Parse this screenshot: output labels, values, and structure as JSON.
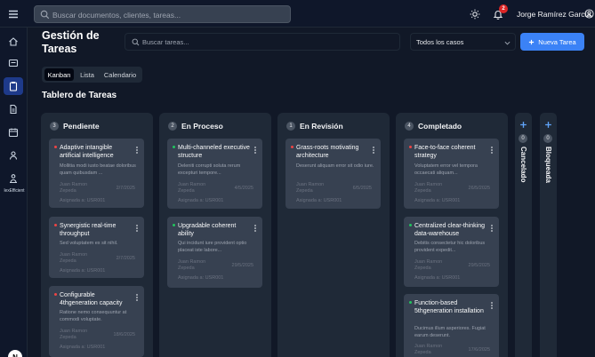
{
  "topbar": {
    "search_placeholder": "Buscar documentos, clientes, tareas...",
    "notifications_count": "2",
    "user_name": "Jorge Ramírez García"
  },
  "sidebar": {
    "items": [
      "home-icon",
      "inbox-icon",
      "clipboard-icon",
      "document-icon",
      "calendar-icon",
      "users-icon",
      "user-network-icon"
    ],
    "active_index": 2,
    "brand": "lexEfficient",
    "avatar_letter": "N"
  },
  "page": {
    "title": "Gestión de Tareas",
    "task_search_placeholder": "Buscar tareas...",
    "case_filter": "Todos los casos",
    "new_task_label": "Nueva Tarea"
  },
  "tabs": [
    {
      "label": "Kanban",
      "active": true
    },
    {
      "label": "Lista",
      "active": false
    },
    {
      "label": "Calendario",
      "active": false
    }
  ],
  "board": {
    "title": "Tablero de Tareas",
    "columns": [
      {
        "name": "Pendiente",
        "count": "3",
        "cards": [
          {
            "title": "Adaptive intangible artificial intelligence",
            "desc": "Mollitia modi iusto beatae doloribus quam quibusdam ...",
            "person": "Juan Ramon Zepeda",
            "date": "2/7/2025",
            "assign": "Asignada a: USR001",
            "priority": "#ef4444"
          },
          {
            "title": "Synergistic real-time throughput",
            "desc": "Sed voluptatem ex sit nihil.",
            "person": "Juan Ramon Zepeda",
            "date": "2/7/2025",
            "assign": "Asignada a: USR001",
            "priority": "#ef4444"
          },
          {
            "title": "Configurable 4thgeneration capacity",
            "desc": "Ratione nemo consequuntur at commodi voluptate.",
            "person": "Juan Ramon Zepeda",
            "date": "18/6/2025",
            "assign": "Asignada a: USR001",
            "priority": "#ef4444"
          }
        ]
      },
      {
        "name": "En Proceso",
        "count": "2",
        "cards": [
          {
            "title": "Multi-channeled executive structure",
            "desc": "Deleniti corrupti soluta rerum excepturi tempore...",
            "person": "Juan Ramon Zepeda",
            "date": "4/5/2025",
            "assign": "Asignada a: USR001",
            "priority": "#22c55e"
          },
          {
            "title": "Upgradable coherent ability",
            "desc": "Qui incidunt iure provident optio placeat iste labore...",
            "person": "Juan Ramon Zepeda",
            "date": "29/5/2025",
            "assign": "Asignada a: USR001",
            "priority": "#22c55e"
          }
        ]
      },
      {
        "name": "En Revisión",
        "count": "1",
        "cards": [
          {
            "title": "Grass-roots motivating architecture",
            "desc": "Deserunt aliquam error sit odio iure.",
            "person": "Juan Ramon Zepeda",
            "date": "6/5/2025",
            "assign": "Asignada a: USR001",
            "priority": "#ef4444"
          }
        ]
      },
      {
        "name": "Completado",
        "count": "4",
        "cards": [
          {
            "title": "Face-to-face coherent strategy",
            "desc": "Voluptatem error vel tempora occaecati aliquam...",
            "person": "Juan Ramon Zepeda",
            "date": "26/5/2025",
            "assign": "Asignada a: USR001",
            "priority": "#ef4444"
          },
          {
            "title": "Centralized clear-thinking data-warehouse",
            "desc": "Debitis consectetur hic doloribus provident expedit...",
            "person": "Juan Ramon Zepeda",
            "date": "29/5/2025",
            "assign": "Asignada a: USR001",
            "priority": "#22c55e"
          },
          {
            "title": "Function-based 5thgeneration installation",
            "desc": "Ducimus illum asperiores. Fugiat earum deserunt.",
            "person": "Juan Ramon Zepeda",
            "date": "17/6/2025",
            "assign": "",
            "priority": "#22c55e"
          }
        ]
      }
    ],
    "collapsed_columns": [
      {
        "name": "Cancelado",
        "count": "0"
      },
      {
        "name": "Bloqueada",
        "count": "0"
      }
    ]
  },
  "colors": {
    "accent": "#3b82f6",
    "high_priority": "#ef4444",
    "low_priority": "#22c55e"
  }
}
